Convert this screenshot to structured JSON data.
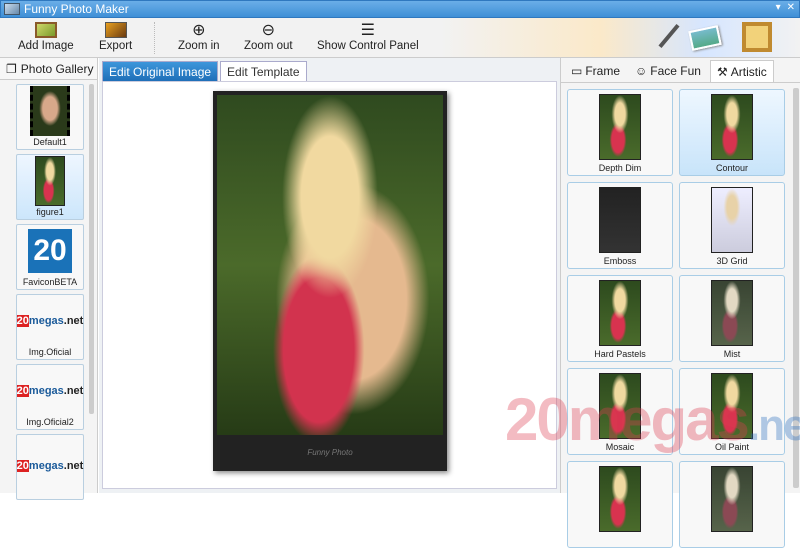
{
  "window": {
    "title": "Funny Photo Maker",
    "minimize": "▾",
    "close": "✕"
  },
  "toolbar": {
    "add_image": "Add Image",
    "export": "Export",
    "zoom_in": "Zoom in",
    "zoom_out": "Zoom out",
    "show_control_panel": "Show Control Panel"
  },
  "left_panel": {
    "tab": "Photo Gallery",
    "items": [
      {
        "label": "Default1"
      },
      {
        "label": "figure1"
      },
      {
        "label": "FaviconBETA"
      },
      {
        "label": "Img.Oficial"
      },
      {
        "label": "Img.Oficial2"
      },
      {
        "label": ""
      }
    ]
  },
  "center": {
    "tabs": [
      "Edit Original Image",
      "Edit Template"
    ],
    "signature": "Funny Photo"
  },
  "right_panel": {
    "tabs": [
      "Frame",
      "Face Fun",
      "Artistic"
    ],
    "effects": [
      "Depth Dim",
      "Contour",
      "Emboss",
      "3D Grid",
      "Hard Pastels",
      "Mist",
      "Mosaic",
      "Oil Paint",
      "",
      ""
    ]
  },
  "watermark": {
    "text": "20megas",
    "suffix": ".net"
  }
}
